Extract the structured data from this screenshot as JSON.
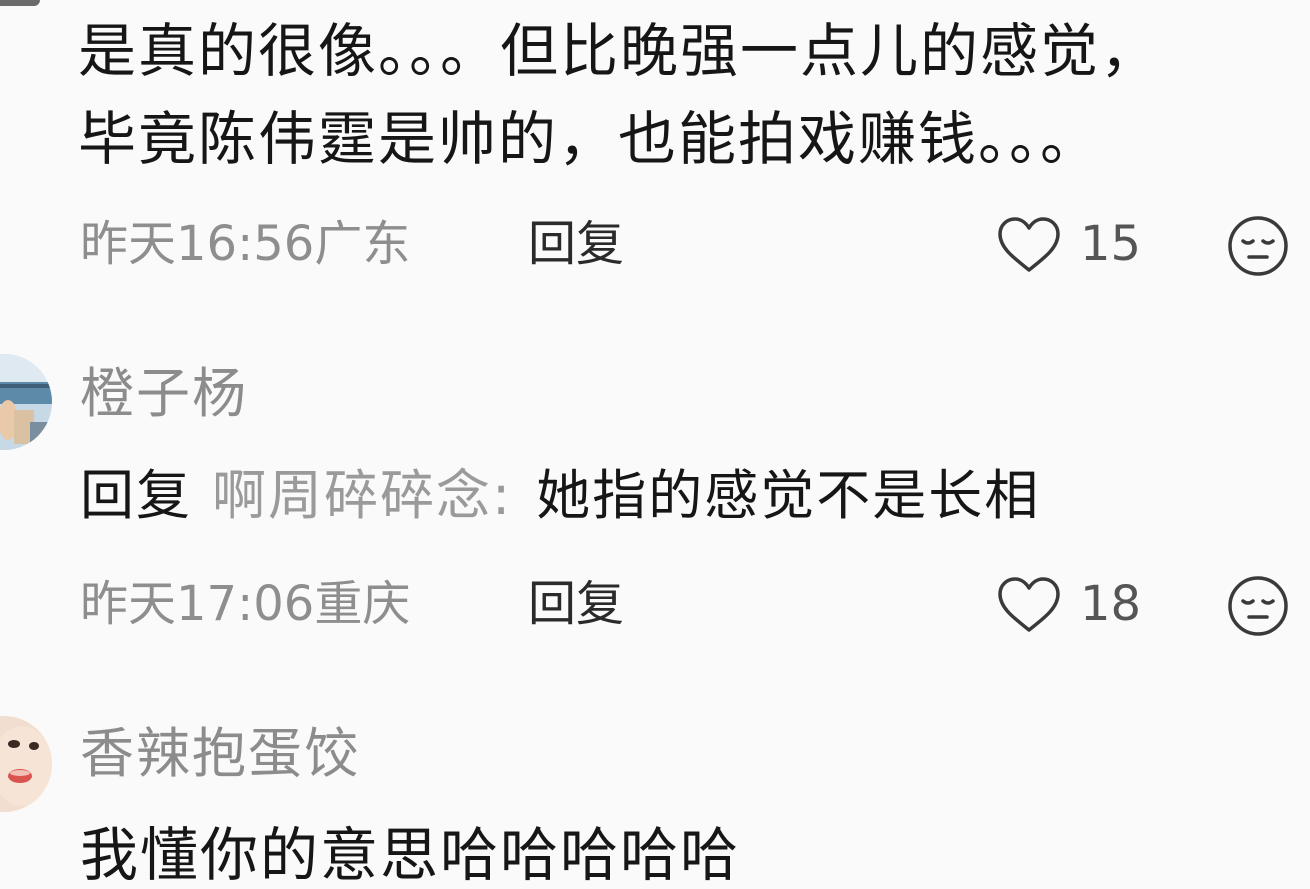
{
  "comments": [
    {
      "text_line1": "是真的很像。。。但比晚强一点儿的感觉，",
      "text_line2": "毕竟陈伟霆是帅的，也能拍戏赚钱。。。",
      "time_location": "昨天16:56广东",
      "reply_label": "回复",
      "like_count": "15"
    },
    {
      "username": "橙子杨",
      "reply_prefix": "回复",
      "reply_target": "啊周碎碎念",
      "reply_colon": ":",
      "reply_text": "她指的感觉不是长相",
      "time_location": "昨天17:06重庆",
      "reply_label": "回复",
      "like_count": "18"
    },
    {
      "username": "香辣抱蛋饺",
      "text_line1": "我懂你的意思哈哈哈哈哈"
    }
  ],
  "colors": {
    "background": "#fafafa",
    "text_primary": "#161616",
    "text_secondary": "#8e8e8e"
  },
  "icons": {
    "like": "heart-outline-icon",
    "emoji": "expressionless-face-icon"
  }
}
